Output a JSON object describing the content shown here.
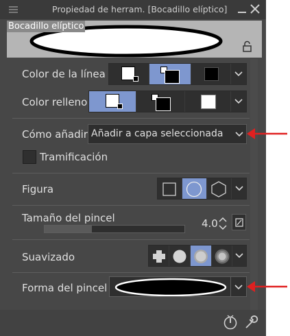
{
  "window": {
    "title": "Propiedad de herram. [Bocadillo elíptico]"
  },
  "preview": {
    "label": "Bocadillo elíptico"
  },
  "properties": {
    "line_color": {
      "label": "Color de la línea",
      "selected_index": 1
    },
    "fill_color": {
      "label": "Color relleno",
      "selected_index": 0
    },
    "add_mode": {
      "label": "Cómo añadir",
      "value": "Añadir a capa seleccionada"
    },
    "hatching": {
      "label": "Tramificación",
      "checked": false
    },
    "shape": {
      "label": "Figura",
      "options": [
        "rectangle-icon",
        "ellipse-icon",
        "polygon-icon"
      ],
      "selected_index": 1
    },
    "brush_size": {
      "label": "Tamaño del pincel",
      "value": "4.0",
      "slider_fraction": 0.34
    },
    "smoothing": {
      "label": "Suavizado",
      "options": [
        "none-icon",
        "weak-icon",
        "medium-icon",
        "strong-icon"
      ],
      "selected_index": 2
    },
    "brush_shape": {
      "label": "Forma del pincel"
    }
  },
  "colors": {
    "panel_bg": "#474747",
    "selected_accent": "#7e97cf",
    "annotation_arrow": "#e02020"
  }
}
